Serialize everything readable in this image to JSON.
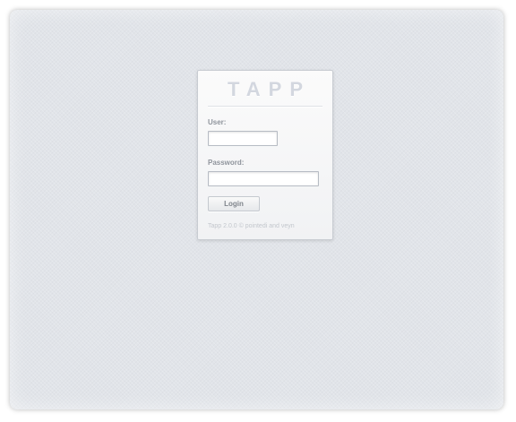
{
  "app": {
    "logo_text": "TAPP"
  },
  "login_form": {
    "user_label": "User:",
    "user_value": "",
    "password_label": "Password:",
    "password_value": "",
    "login_button_label": "Login"
  },
  "footer": {
    "text": "Tapp 2.0.0 © pointedi and veyn"
  },
  "colors": {
    "background": "#e1e4e9",
    "panel": "#f6f7f8",
    "logo": "#d3d7df",
    "label": "#8f949c"
  }
}
